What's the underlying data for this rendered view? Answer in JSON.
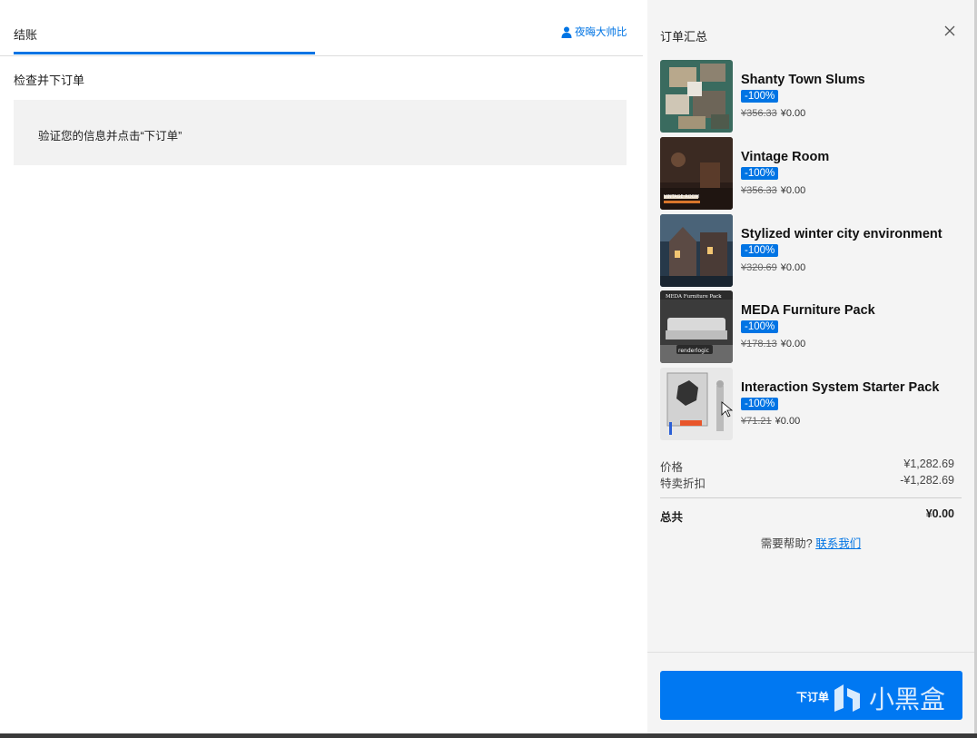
{
  "checkout": {
    "tab_label": "结账",
    "user_name": "夜晦大帅比",
    "section_title": "检查并下订单",
    "notice": "验证您的信息并点击“下订单”"
  },
  "summary": {
    "title": "订单汇总",
    "items": [
      {
        "name": "Shanty Town Slums",
        "badge": "-100%",
        "old_price": "¥356.33",
        "new_price": "¥0.00"
      },
      {
        "name": "Vintage Room",
        "badge": "-100%",
        "old_price": "¥356.33",
        "new_price": "¥0.00"
      },
      {
        "name": "Stylized winter city environment",
        "badge": "-100%",
        "old_price": "¥320.69",
        "new_price": "¥0.00"
      },
      {
        "name": "MEDA Furniture Pack",
        "badge": "-100%",
        "old_price": "¥178.13",
        "new_price": "¥0.00"
      },
      {
        "name": "Interaction System Starter Pack",
        "badge": "-100%",
        "old_price": "¥71.21",
        "new_price": "¥0.00"
      }
    ],
    "thumb_texts": {
      "vintage": "VINTAGE ROOM",
      "meda": "MEDA Furniture Pack",
      "meda_logo": "renderlogic"
    },
    "price_label": "价格",
    "price_value": "¥1,282.69",
    "discount_label": "特卖折扣",
    "discount_value": "-¥1,282.69",
    "total_label": "总共",
    "total_value": "¥0.00",
    "help_text": "需要帮助?",
    "help_link": "联系我们",
    "place_order": "下订单",
    "watermark": "小黑盒"
  },
  "colors": {
    "accent": "#0074e4",
    "button": "#0078f2",
    "panel": "#f4f4f4"
  }
}
